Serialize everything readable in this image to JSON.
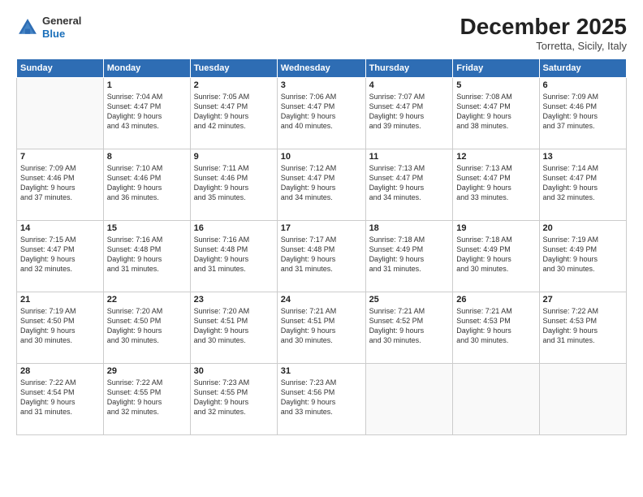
{
  "logo": {
    "general": "General",
    "blue": "Blue"
  },
  "header": {
    "month": "December 2025",
    "location": "Torretta, Sicily, Italy"
  },
  "weekdays": [
    "Sunday",
    "Monday",
    "Tuesday",
    "Wednesday",
    "Thursday",
    "Friday",
    "Saturday"
  ],
  "weeks": [
    [
      {
        "day": "",
        "info": ""
      },
      {
        "day": "1",
        "info": "Sunrise: 7:04 AM\nSunset: 4:47 PM\nDaylight: 9 hours\nand 43 minutes."
      },
      {
        "day": "2",
        "info": "Sunrise: 7:05 AM\nSunset: 4:47 PM\nDaylight: 9 hours\nand 42 minutes."
      },
      {
        "day": "3",
        "info": "Sunrise: 7:06 AM\nSunset: 4:47 PM\nDaylight: 9 hours\nand 40 minutes."
      },
      {
        "day": "4",
        "info": "Sunrise: 7:07 AM\nSunset: 4:47 PM\nDaylight: 9 hours\nand 39 minutes."
      },
      {
        "day": "5",
        "info": "Sunrise: 7:08 AM\nSunset: 4:47 PM\nDaylight: 9 hours\nand 38 minutes."
      },
      {
        "day": "6",
        "info": "Sunrise: 7:09 AM\nSunset: 4:46 PM\nDaylight: 9 hours\nand 37 minutes."
      }
    ],
    [
      {
        "day": "7",
        "info": "Sunrise: 7:09 AM\nSunset: 4:46 PM\nDaylight: 9 hours\nand 37 minutes."
      },
      {
        "day": "8",
        "info": "Sunrise: 7:10 AM\nSunset: 4:46 PM\nDaylight: 9 hours\nand 36 minutes."
      },
      {
        "day": "9",
        "info": "Sunrise: 7:11 AM\nSunset: 4:46 PM\nDaylight: 9 hours\nand 35 minutes."
      },
      {
        "day": "10",
        "info": "Sunrise: 7:12 AM\nSunset: 4:47 PM\nDaylight: 9 hours\nand 34 minutes."
      },
      {
        "day": "11",
        "info": "Sunrise: 7:13 AM\nSunset: 4:47 PM\nDaylight: 9 hours\nand 34 minutes."
      },
      {
        "day": "12",
        "info": "Sunrise: 7:13 AM\nSunset: 4:47 PM\nDaylight: 9 hours\nand 33 minutes."
      },
      {
        "day": "13",
        "info": "Sunrise: 7:14 AM\nSunset: 4:47 PM\nDaylight: 9 hours\nand 32 minutes."
      }
    ],
    [
      {
        "day": "14",
        "info": "Sunrise: 7:15 AM\nSunset: 4:47 PM\nDaylight: 9 hours\nand 32 minutes."
      },
      {
        "day": "15",
        "info": "Sunrise: 7:16 AM\nSunset: 4:48 PM\nDaylight: 9 hours\nand 31 minutes."
      },
      {
        "day": "16",
        "info": "Sunrise: 7:16 AM\nSunset: 4:48 PM\nDaylight: 9 hours\nand 31 minutes."
      },
      {
        "day": "17",
        "info": "Sunrise: 7:17 AM\nSunset: 4:48 PM\nDaylight: 9 hours\nand 31 minutes."
      },
      {
        "day": "18",
        "info": "Sunrise: 7:18 AM\nSunset: 4:49 PM\nDaylight: 9 hours\nand 31 minutes."
      },
      {
        "day": "19",
        "info": "Sunrise: 7:18 AM\nSunset: 4:49 PM\nDaylight: 9 hours\nand 30 minutes."
      },
      {
        "day": "20",
        "info": "Sunrise: 7:19 AM\nSunset: 4:49 PM\nDaylight: 9 hours\nand 30 minutes."
      }
    ],
    [
      {
        "day": "21",
        "info": "Sunrise: 7:19 AM\nSunset: 4:50 PM\nDaylight: 9 hours\nand 30 minutes."
      },
      {
        "day": "22",
        "info": "Sunrise: 7:20 AM\nSunset: 4:50 PM\nDaylight: 9 hours\nand 30 minutes."
      },
      {
        "day": "23",
        "info": "Sunrise: 7:20 AM\nSunset: 4:51 PM\nDaylight: 9 hours\nand 30 minutes."
      },
      {
        "day": "24",
        "info": "Sunrise: 7:21 AM\nSunset: 4:51 PM\nDaylight: 9 hours\nand 30 minutes."
      },
      {
        "day": "25",
        "info": "Sunrise: 7:21 AM\nSunset: 4:52 PM\nDaylight: 9 hours\nand 30 minutes."
      },
      {
        "day": "26",
        "info": "Sunrise: 7:21 AM\nSunset: 4:53 PM\nDaylight: 9 hours\nand 30 minutes."
      },
      {
        "day": "27",
        "info": "Sunrise: 7:22 AM\nSunset: 4:53 PM\nDaylight: 9 hours\nand 31 minutes."
      }
    ],
    [
      {
        "day": "28",
        "info": "Sunrise: 7:22 AM\nSunset: 4:54 PM\nDaylight: 9 hours\nand 31 minutes."
      },
      {
        "day": "29",
        "info": "Sunrise: 7:22 AM\nSunset: 4:55 PM\nDaylight: 9 hours\nand 32 minutes."
      },
      {
        "day": "30",
        "info": "Sunrise: 7:23 AM\nSunset: 4:55 PM\nDaylight: 9 hours\nand 32 minutes."
      },
      {
        "day": "31",
        "info": "Sunrise: 7:23 AM\nSunset: 4:56 PM\nDaylight: 9 hours\nand 33 minutes."
      },
      {
        "day": "",
        "info": ""
      },
      {
        "day": "",
        "info": ""
      },
      {
        "day": "",
        "info": ""
      }
    ]
  ]
}
